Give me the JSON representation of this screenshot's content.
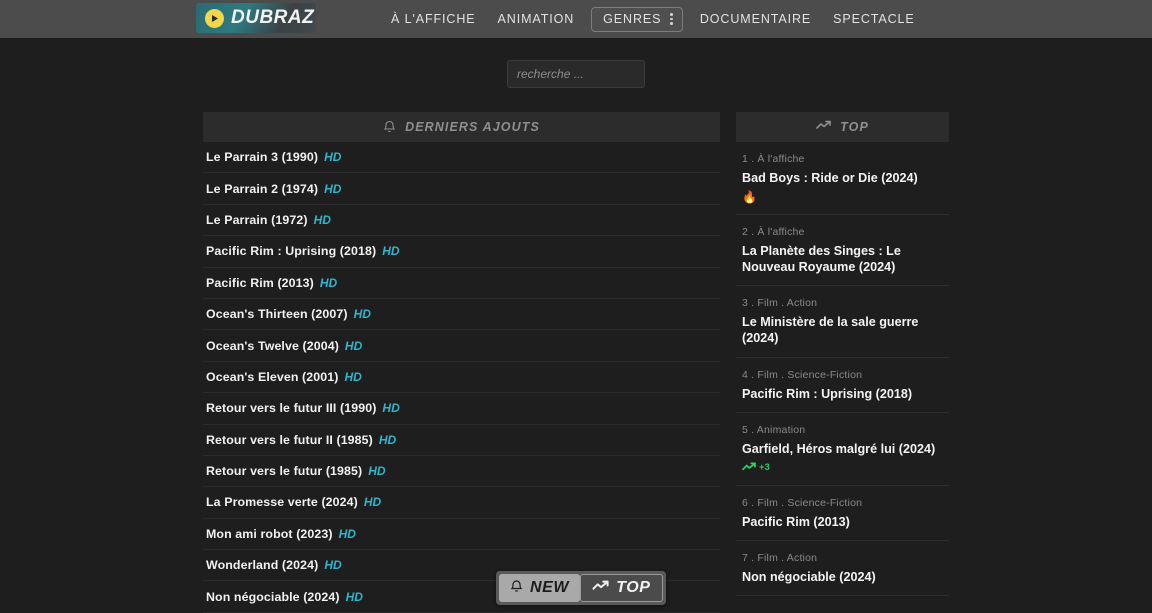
{
  "header": {
    "logo_text": "DUBRAZ",
    "logo_icon": "play-circle-icon",
    "nav": [
      {
        "label": "À L'AFFICHE",
        "boxed": false
      },
      {
        "label": "ANIMATION",
        "boxed": false
      },
      {
        "label": "GENRES",
        "boxed": true,
        "icon": "vertical-dots-icon"
      },
      {
        "label": "DOCUMENTAIRE",
        "boxed": false
      },
      {
        "label": "SPECTACLE",
        "boxed": false
      }
    ]
  },
  "search": {
    "value": "",
    "placeholder": "recherche ..."
  },
  "new_panel": {
    "header_label": "DERNIERS AJOUTS",
    "header_icon": "bell-icon",
    "items": [
      {
        "title": "Le Parrain 3 (1990)",
        "quality": "HD"
      },
      {
        "title": "Le Parrain 2 (1974)",
        "quality": "HD"
      },
      {
        "title": "Le Parrain (1972)",
        "quality": "HD"
      },
      {
        "title": "Pacific Rim : Uprising (2018)",
        "quality": "HD"
      },
      {
        "title": "Pacific Rim (2013)",
        "quality": "HD"
      },
      {
        "title": "Ocean's Thirteen (2007)",
        "quality": "HD"
      },
      {
        "title": "Ocean's Twelve (2004)",
        "quality": "HD"
      },
      {
        "title": "Ocean's Eleven (2001)",
        "quality": "HD"
      },
      {
        "title": "Retour vers le futur III (1990)",
        "quality": "HD"
      },
      {
        "title": "Retour vers le futur II (1985)",
        "quality": "HD"
      },
      {
        "title": "Retour vers le futur (1985)",
        "quality": "HD"
      },
      {
        "title": "La Promesse verte (2024)",
        "quality": "HD"
      },
      {
        "title": "Mon ami robot (2023)",
        "quality": "HD"
      },
      {
        "title": "Wonderland (2024)",
        "quality": "HD"
      },
      {
        "title": "Non négociable (2024)",
        "quality": "HD"
      }
    ]
  },
  "top_panel": {
    "header_label": "TOP",
    "header_icon": "trending-up-icon",
    "items": [
      {
        "meta": "1 . À l'affiche",
        "title": "Bad Boys : Ride or Die (2024)",
        "badge_icon": "fire-icon",
        "badge_text": ""
      },
      {
        "meta": "2 . À l'affiche",
        "title": "La Planète des Singes : Le Nouveau Royaume (2024)",
        "badge_icon": "",
        "badge_text": ""
      },
      {
        "meta": "3 . Film . Action",
        "title": "Le Ministère de la sale guerre (2024)",
        "badge_icon": "",
        "badge_text": ""
      },
      {
        "meta": "4 . Film . Science-Fiction",
        "title": "Pacific Rim : Uprising (2018)",
        "badge_icon": "",
        "badge_text": ""
      },
      {
        "meta": "5 . Animation",
        "title": "Garfield, Héros malgré lui (2024)",
        "badge_icon": "trending-up-icon",
        "badge_text": "+3"
      },
      {
        "meta": "6 . Film . Science-Fiction",
        "title": "Pacific Rim (2013)",
        "badge_icon": "",
        "badge_text": ""
      },
      {
        "meta": "7 . Film . Action",
        "title": "Non négociable (2024)",
        "badge_icon": "",
        "badge_text": ""
      }
    ]
  },
  "floating_toggle": {
    "new_label": "NEW",
    "new_icon": "bell-icon",
    "top_label": "TOP",
    "top_icon": "trending-up-icon",
    "active": "TOP"
  },
  "colors": {
    "header_bg": "#4c4c4c",
    "page_bg": "#1e1e1e",
    "panel_head_bg": "#2c2c2c",
    "accent_hd": "#2eb6cf",
    "accent_up": "#2fcf63",
    "logo_play": "#f2d64b"
  }
}
